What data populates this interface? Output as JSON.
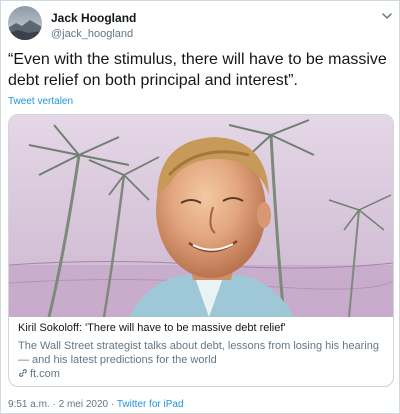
{
  "author": {
    "name": "Jack Hoogland",
    "handle": "@jack_hoogland"
  },
  "tweet": {
    "text": "“Even with the stimulus, there will have to be massive debt relief on both principal and interest”.",
    "translate_label": "Tweet vertalen"
  },
  "card": {
    "title": "Kiril Sokoloff: 'There will have to be massive debt relief'",
    "description": "The Wall Street strategist talks about debt, lessons from losing his hearing — and his latest predictions for the world",
    "domain": "ft.com"
  },
  "meta": {
    "time": "9:51 a.m.",
    "separator": "·",
    "date": "2 mei 2020",
    "source": "Twitter for iPad"
  },
  "icons": {
    "menu": "chevron-down-icon",
    "link": "link-icon"
  },
  "colors": {
    "link_blue": "#1b95e0",
    "secondary_text": "#657786",
    "primary_text": "#14171a"
  }
}
